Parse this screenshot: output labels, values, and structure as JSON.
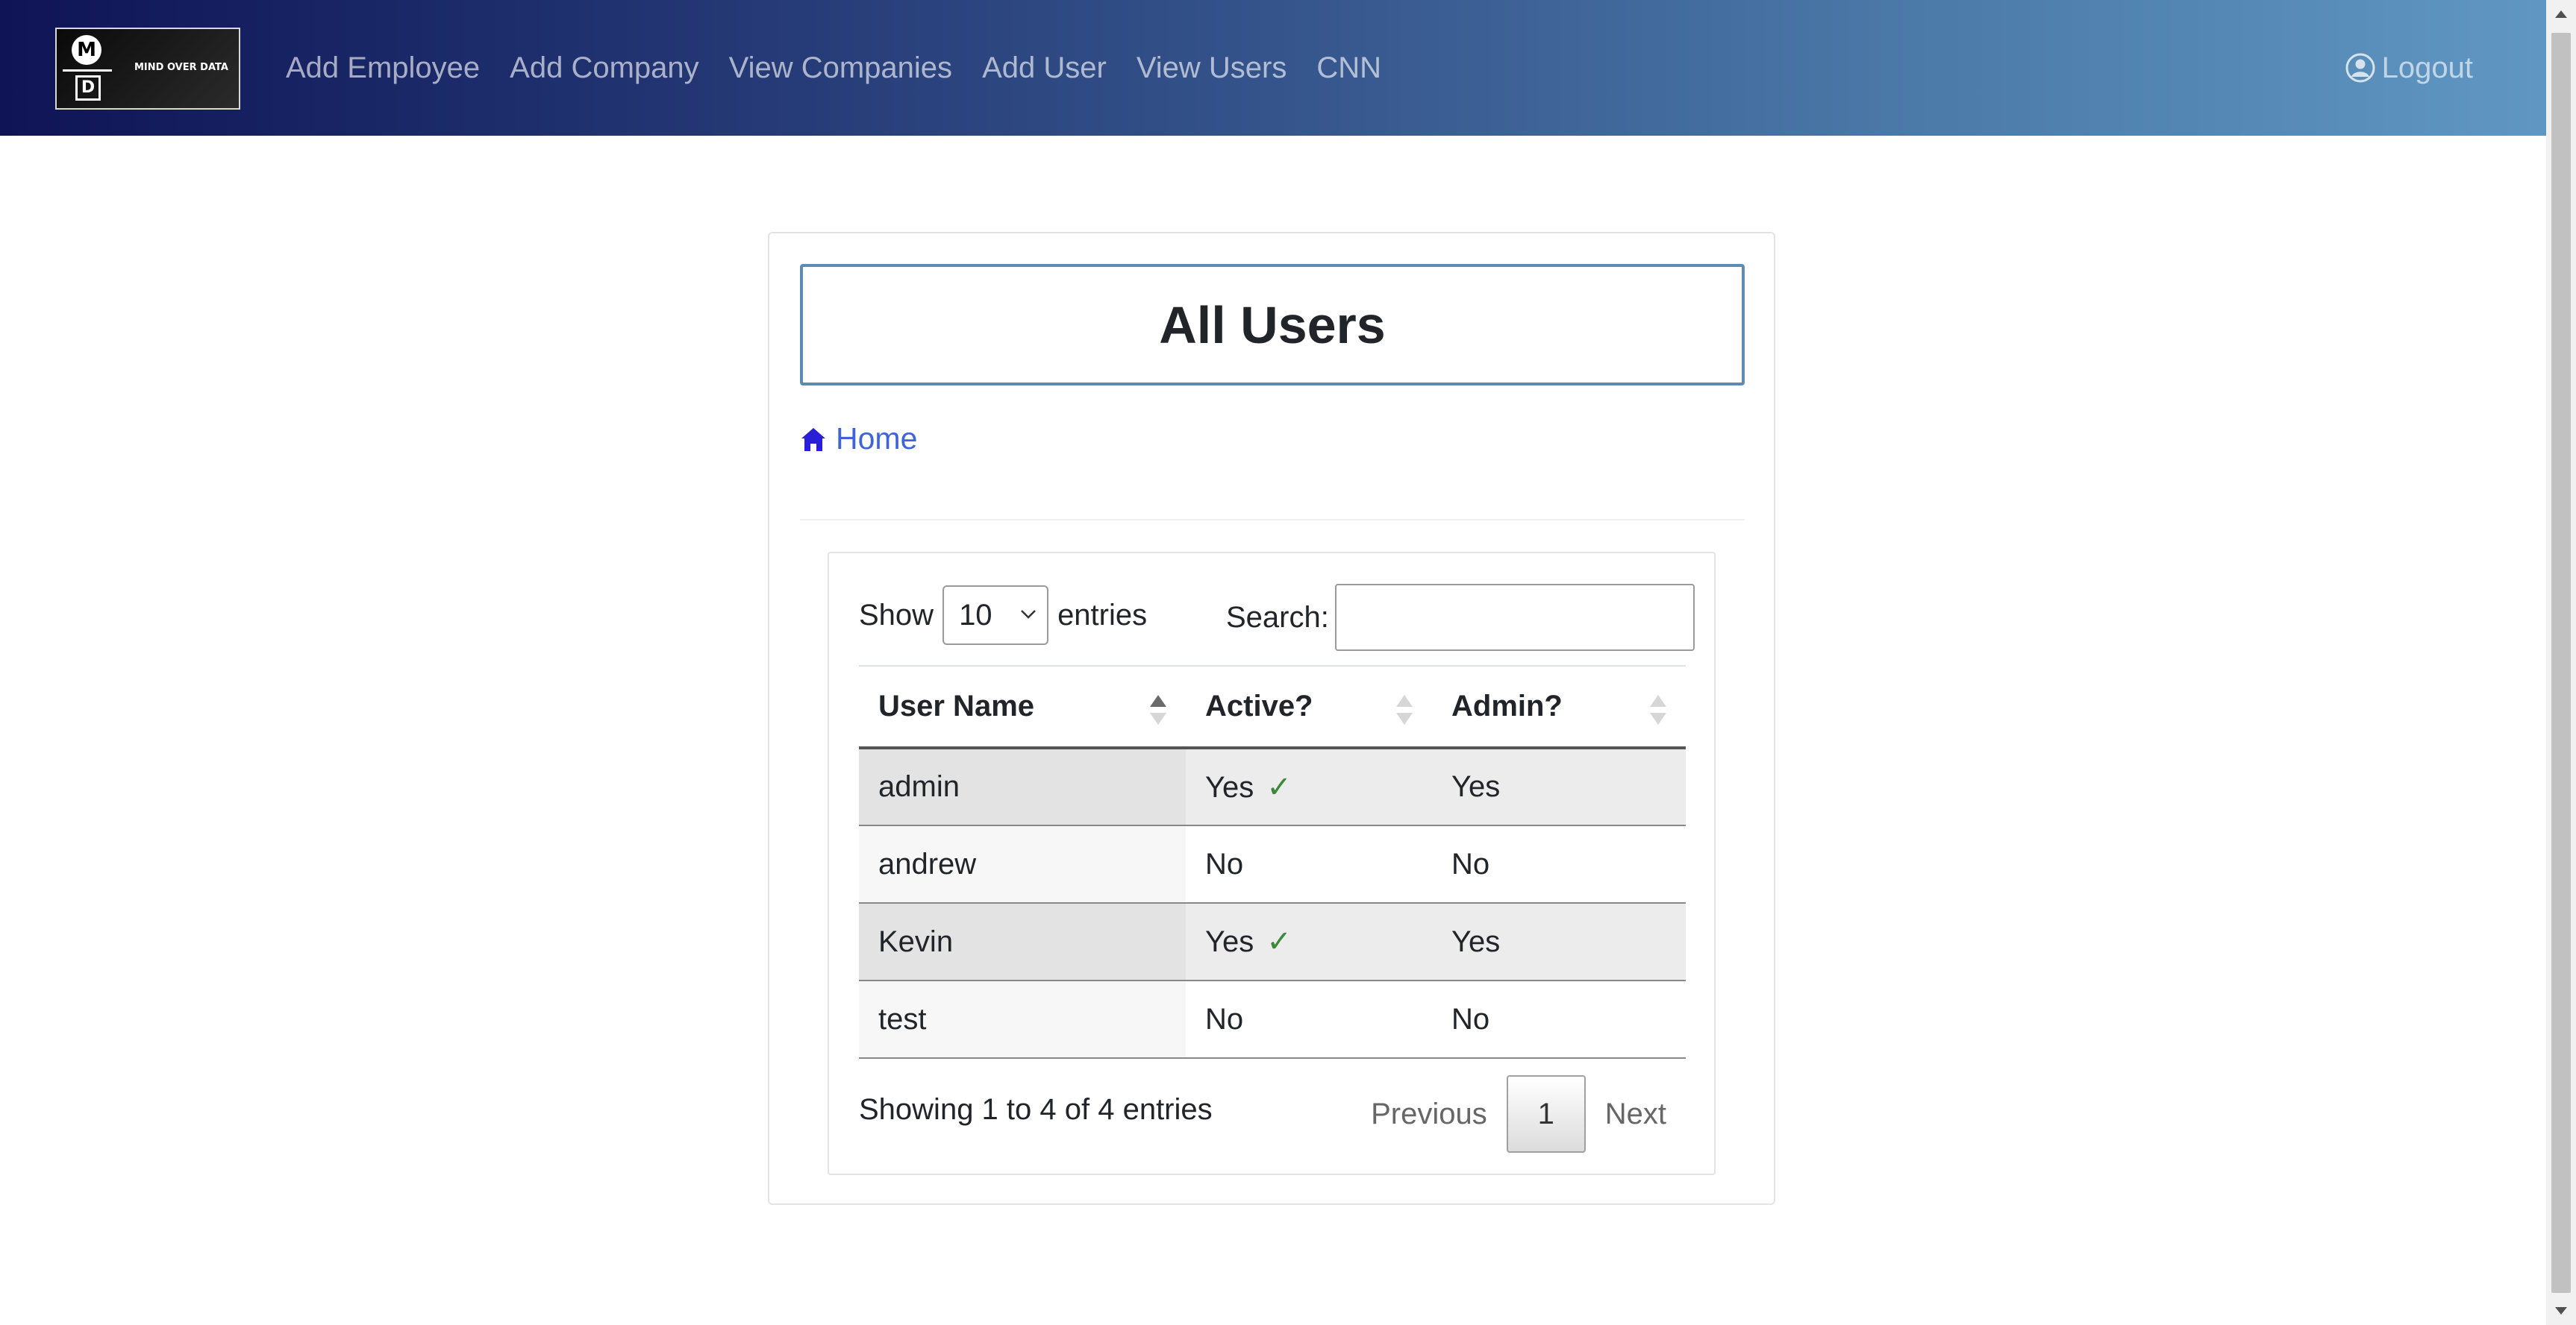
{
  "brand": {
    "logo_letter_top": "M",
    "logo_letter_bottom": "D",
    "logo_text": "MIND OVER DATA"
  },
  "nav": {
    "links": [
      "Add Employee",
      "Add Company",
      "View Companies",
      "Add User",
      "View Users",
      "CNN"
    ],
    "logout_label": "Logout",
    "gradient_colors": [
      "#0f1456",
      "#6097c2"
    ]
  },
  "page": {
    "title": "All Users",
    "breadcrumb_home": "Home",
    "accent_color": "#3f63d8"
  },
  "datatable": {
    "length_show_label": "Show",
    "length_value": "10",
    "length_entries_label": "entries",
    "search_label": "Search:",
    "search_value": "",
    "columns": [
      "User Name",
      "Active?",
      "Admin?"
    ],
    "sorted_column": "User Name",
    "sort_direction": "ascending",
    "rows": [
      {
        "user_name": "admin",
        "active": "Yes",
        "active_check": "✓",
        "admin": "Yes"
      },
      {
        "user_name": "andrew",
        "active": "No",
        "active_check": "",
        "admin": "No"
      },
      {
        "user_name": "Kevin",
        "active": "Yes",
        "active_check": "✓",
        "admin": "Yes"
      },
      {
        "user_name": "test",
        "active": "No",
        "active_check": "",
        "admin": "No"
      }
    ],
    "info": "Showing 1 to 4 of 4 entries",
    "pagination": {
      "previous_label": "Previous",
      "current_page": "1",
      "next_label": "Next"
    }
  },
  "icons": {
    "logout": "user-circle-icon",
    "home": "home-icon",
    "select": "chevron-down-icon",
    "sort": "sort-arrows-icon"
  }
}
